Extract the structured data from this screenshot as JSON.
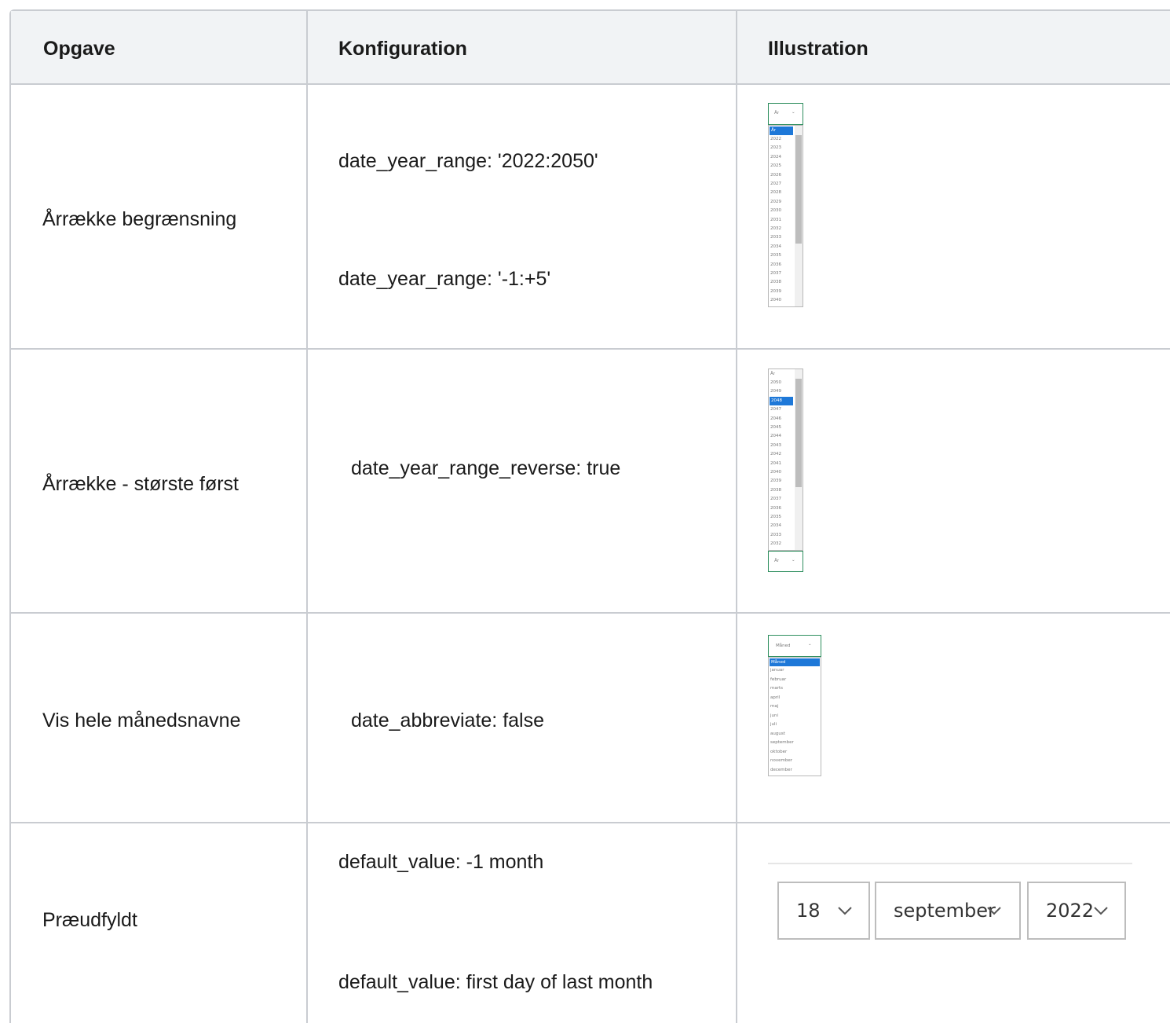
{
  "header": {
    "col1": "Opgave",
    "col2": "Konfiguration",
    "col3": "Illustration"
  },
  "rows": [
    {
      "task": "Årrække begrænsning",
      "config": [
        "date_year_range: '2022:2050'",
        "date_year_range: '-1:+5'"
      ]
    },
    {
      "task": "Årrække - største først",
      "config": [
        "date_year_range_reverse: true"
      ]
    },
    {
      "task": "Vis hele månedsnavne",
      "config": [
        "date_abbreviate: false"
      ]
    },
    {
      "task": "Præudfyldt",
      "config": [
        "default_value: -1 month",
        "default_value: first day of last month"
      ]
    }
  ],
  "illustrations": {
    "year_asc": {
      "header_label": "År",
      "selected": "År",
      "options": [
        "2022",
        "2023",
        "2024",
        "2025",
        "2026",
        "2027",
        "2028",
        "2029",
        "2030",
        "2031",
        "2032",
        "2033",
        "2034",
        "2035",
        "2036",
        "2037",
        "2038",
        "2039",
        "2040"
      ]
    },
    "year_desc": {
      "first_label": "År",
      "options": [
        "2050",
        "2049",
        "2048",
        "2047",
        "2046",
        "2045",
        "2044",
        "2043",
        "2042",
        "2041",
        "2040",
        "2039",
        "2038",
        "2037",
        "2036",
        "2035",
        "2034",
        "2033",
        "2032"
      ],
      "selected": "2048",
      "footer_label": "År"
    },
    "months": {
      "header_label": "Måned",
      "selected": "Måned",
      "options": [
        "januar",
        "februar",
        "marts",
        "april",
        "maj",
        "juni",
        "juli",
        "august",
        "september",
        "oktober",
        "november",
        "december"
      ]
    },
    "prefilled": {
      "day": "18",
      "month": "september",
      "year": "2022"
    }
  },
  "colors": {
    "border": "#c9ccd1",
    "header_bg": "#f1f3f5",
    "select_highlight": "#1e78d8",
    "focus_border": "#2f8f5f"
  }
}
